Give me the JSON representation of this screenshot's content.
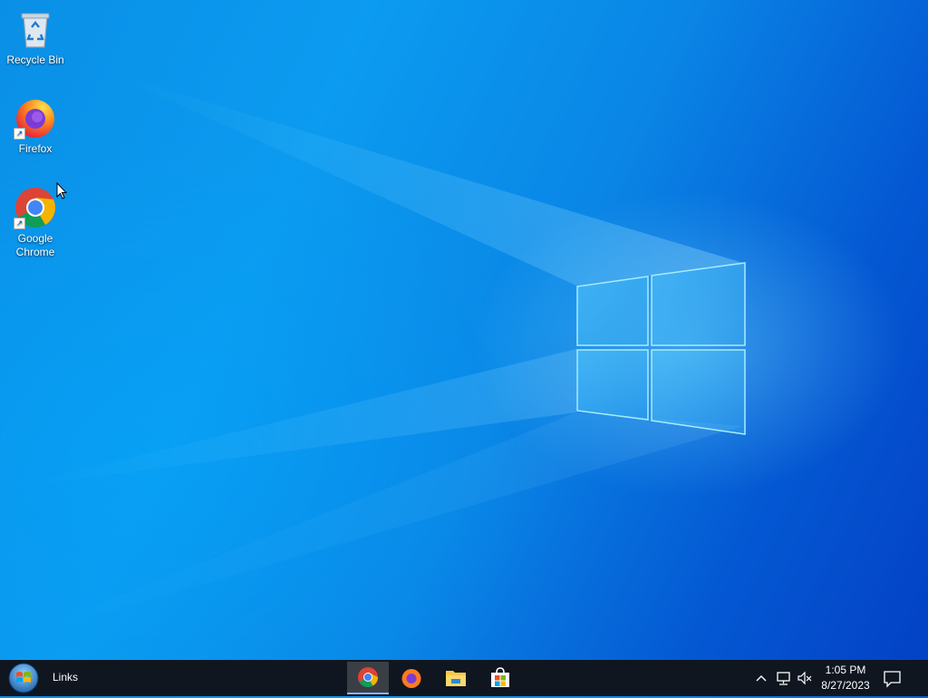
{
  "desktop": {
    "icons": [
      {
        "label": "Recycle Bin",
        "icon": "recycle-bin-icon"
      },
      {
        "label": "Firefox",
        "icon": "firefox-icon"
      },
      {
        "label": "Google Chrome",
        "icon": "chrome-icon"
      }
    ],
    "wallpaper": "windows-10-hero"
  },
  "taskbar": {
    "start_icon": "windows-start-orb-icon",
    "toolbar_label": "Links",
    "pinned": [
      {
        "name": "Google Chrome",
        "icon": "chrome-icon",
        "active": true
      },
      {
        "name": "Firefox",
        "icon": "firefox-icon",
        "active": false
      },
      {
        "name": "File Explorer",
        "icon": "folder-icon",
        "active": false
      },
      {
        "name": "Microsoft Store",
        "icon": "store-icon",
        "active": false
      }
    ],
    "tray": {
      "icons": [
        "chevron-up-icon",
        "network-icon",
        "volume-muted-icon"
      ],
      "time": "1:05 PM",
      "date": "8/27/2023",
      "notification_icon": "notification-icon"
    }
  },
  "colors": {
    "taskbar": "#0f1620",
    "wallpaper_light": "#0b9bf0",
    "wallpaper_dark": "#0340c4"
  }
}
